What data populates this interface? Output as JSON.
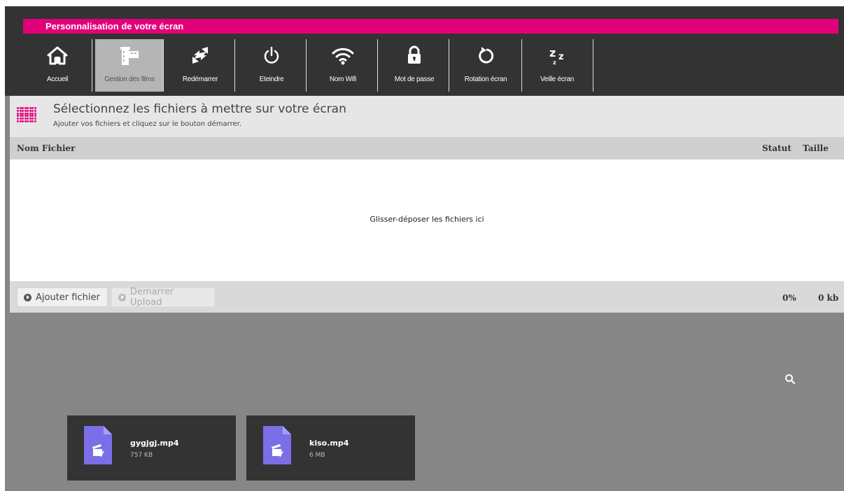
{
  "app": {
    "title": "Personnalisation de votre écran",
    "accent": "#e2007a"
  },
  "nav": [
    {
      "label": "Accueil",
      "icon": "home-icon"
    },
    {
      "label": "Gestion des films",
      "icon": "film-icon",
      "active": true
    },
    {
      "label": "Redémarrer",
      "icon": "refresh-icon"
    },
    {
      "label": "Eteindre",
      "icon": "power-icon"
    },
    {
      "label": "Nom Wifi",
      "icon": "wifi-icon"
    },
    {
      "label": "Mot de passe",
      "icon": "lock-icon"
    },
    {
      "label": "Rotation écran",
      "icon": "rotate-icon"
    },
    {
      "label": "Veille écran",
      "icon": "sleep-icon"
    }
  ],
  "upload": {
    "title": "Sélectionnez les fichiers à mettre sur votre écran",
    "subtitle": "Ajouter vos fichiers et cliquez sur le bouton démarrer.",
    "columns": {
      "name": "Nom Fichier",
      "status": "Statut",
      "size": "Taille"
    },
    "drop_message": "Glisser-déposer les fichiers ici",
    "add_button": "Ajouter fichier",
    "start_button": "Demarrer Upload",
    "total_progress": "0%",
    "total_size": "0 kb"
  },
  "files": [
    {
      "name": "gygjgj.mp4",
      "size": "757 KB"
    },
    {
      "name": "kiso.mp4",
      "size": "6 MB"
    }
  ]
}
